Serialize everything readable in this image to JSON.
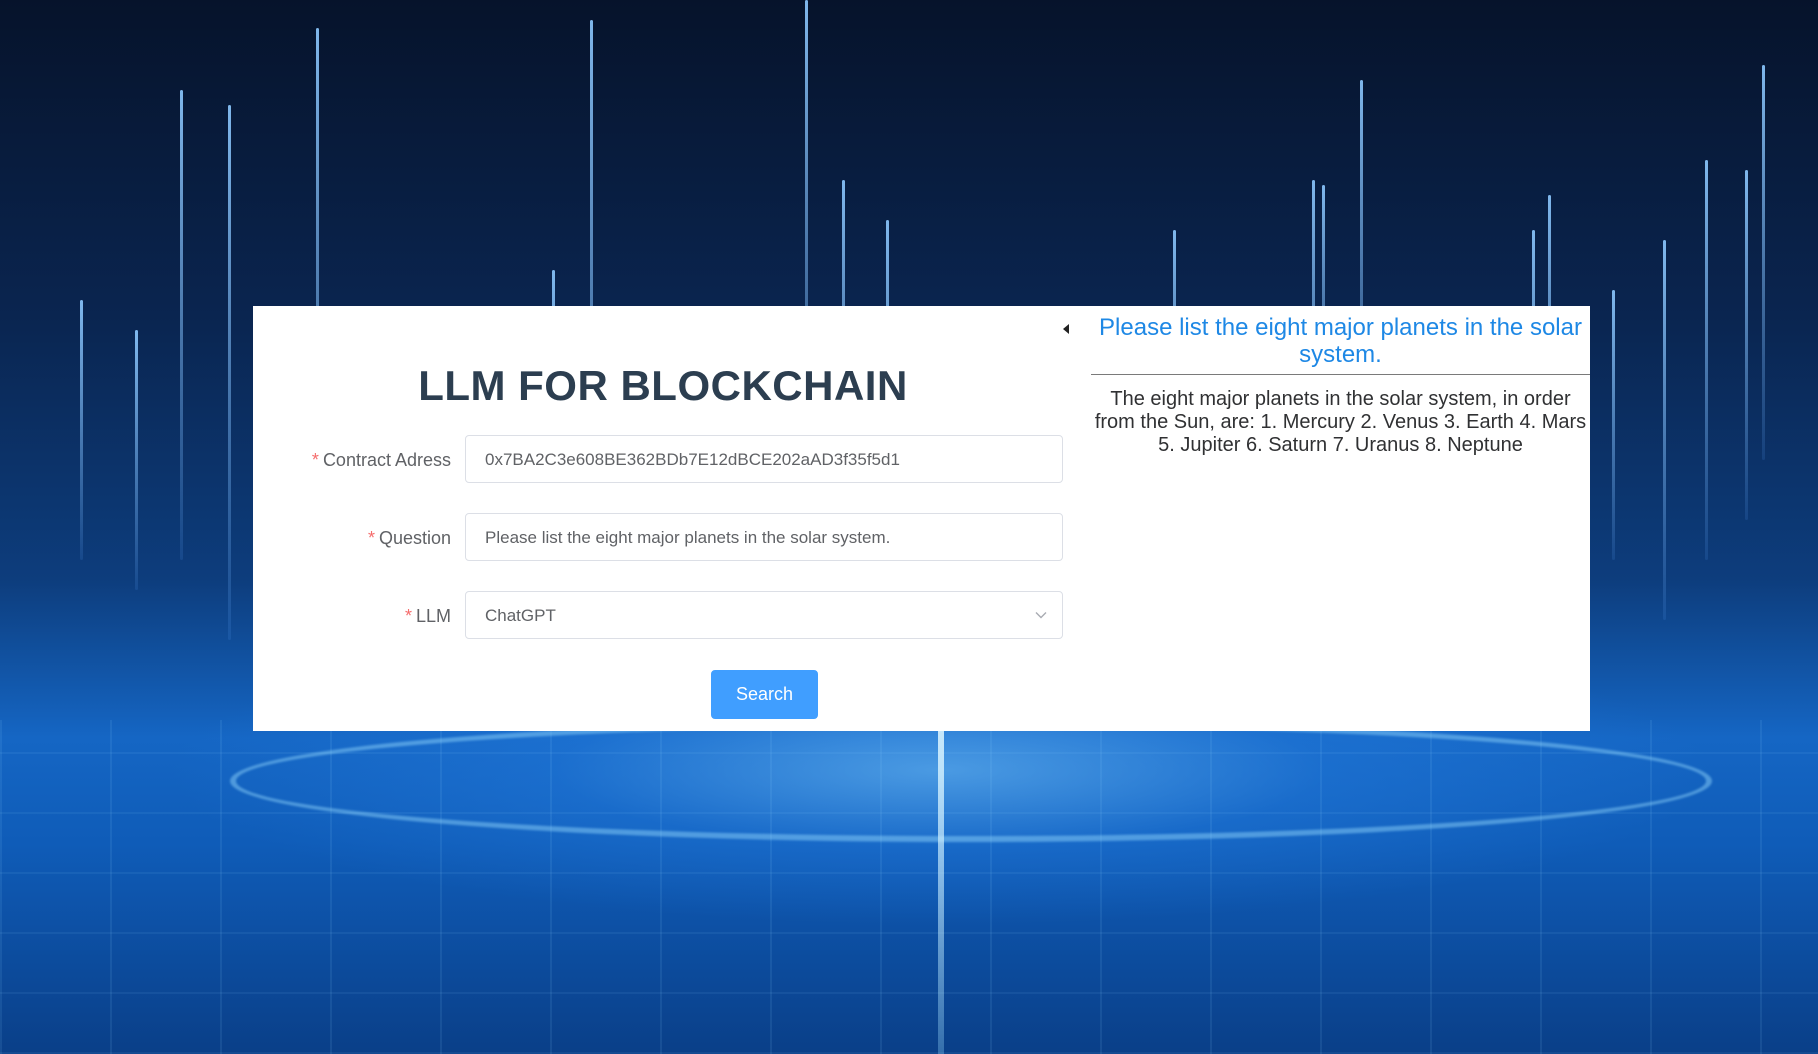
{
  "page": {
    "title": "LLM FOR BLOCKCHAIN"
  },
  "form": {
    "contract": {
      "required_mark": "*",
      "label": "Contract Adress",
      "value": "0x7BA2C3e608BE362BDb7E12dBCE202aAD3f35f5d1"
    },
    "question": {
      "required_mark": "*",
      "label": "Question",
      "value": "Please list the eight major planets in the solar system."
    },
    "llm": {
      "required_mark": "*",
      "label": "LLM",
      "selected": "ChatGPT",
      "icon": "chevron-down-icon"
    },
    "search_label": "Search"
  },
  "panel": {
    "collapse_icon": "caret-left-icon",
    "question_title": "Please list the eight major planets in the solar system.",
    "answer": "The eight major planets in the solar system, in order from the Sun, are: 1. Mercury 2. Venus 3. Earth 4. Mars 5. Jupiter 6. Saturn 7. Uranus 8. Neptune"
  },
  "colors": {
    "accent": "#409eff",
    "title_text": "#2c3e50",
    "answer_title": "#1e88e5",
    "required": "#f56c6c"
  }
}
